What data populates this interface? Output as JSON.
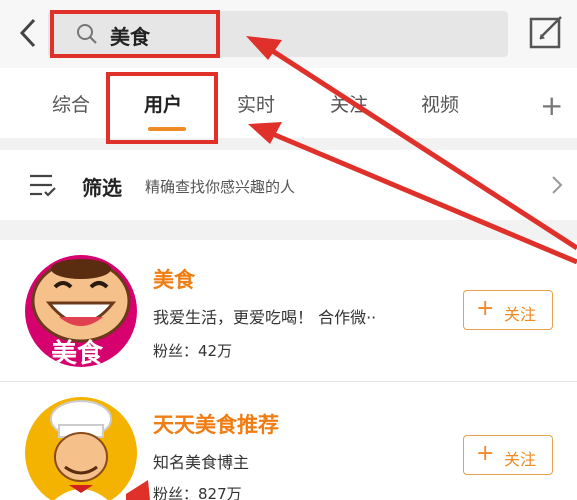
{
  "search": {
    "query": "美食"
  },
  "tabs": [
    {
      "label": "综合",
      "active": false
    },
    {
      "label": "用户",
      "active": true
    },
    {
      "label": "实时",
      "active": false
    },
    {
      "label": "关注",
      "active": false
    },
    {
      "label": "视频",
      "active": false
    }
  ],
  "filter": {
    "title": "筛选",
    "subtitle": "精确查找你感兴趣的人"
  },
  "users": [
    {
      "name": "美食",
      "bio": "我爱生活，更爱吃喝！ 合作微··",
      "fans": "粉丝：42万",
      "follow_label": "关注",
      "avatar_text": "美食"
    },
    {
      "name": "天天美食推荐",
      "bio": "知名美食博主",
      "fans": "粉丝：827万",
      "follow_label": "关注"
    }
  ],
  "colors": {
    "accent": "#f08a24",
    "annotation": "#e0302a"
  },
  "icons": {
    "back": "chevron-left-icon",
    "search": "search-icon",
    "edit": "edit-icon",
    "add": "plus-icon",
    "filter": "filter-list-icon",
    "more": "chevron-right-icon"
  }
}
